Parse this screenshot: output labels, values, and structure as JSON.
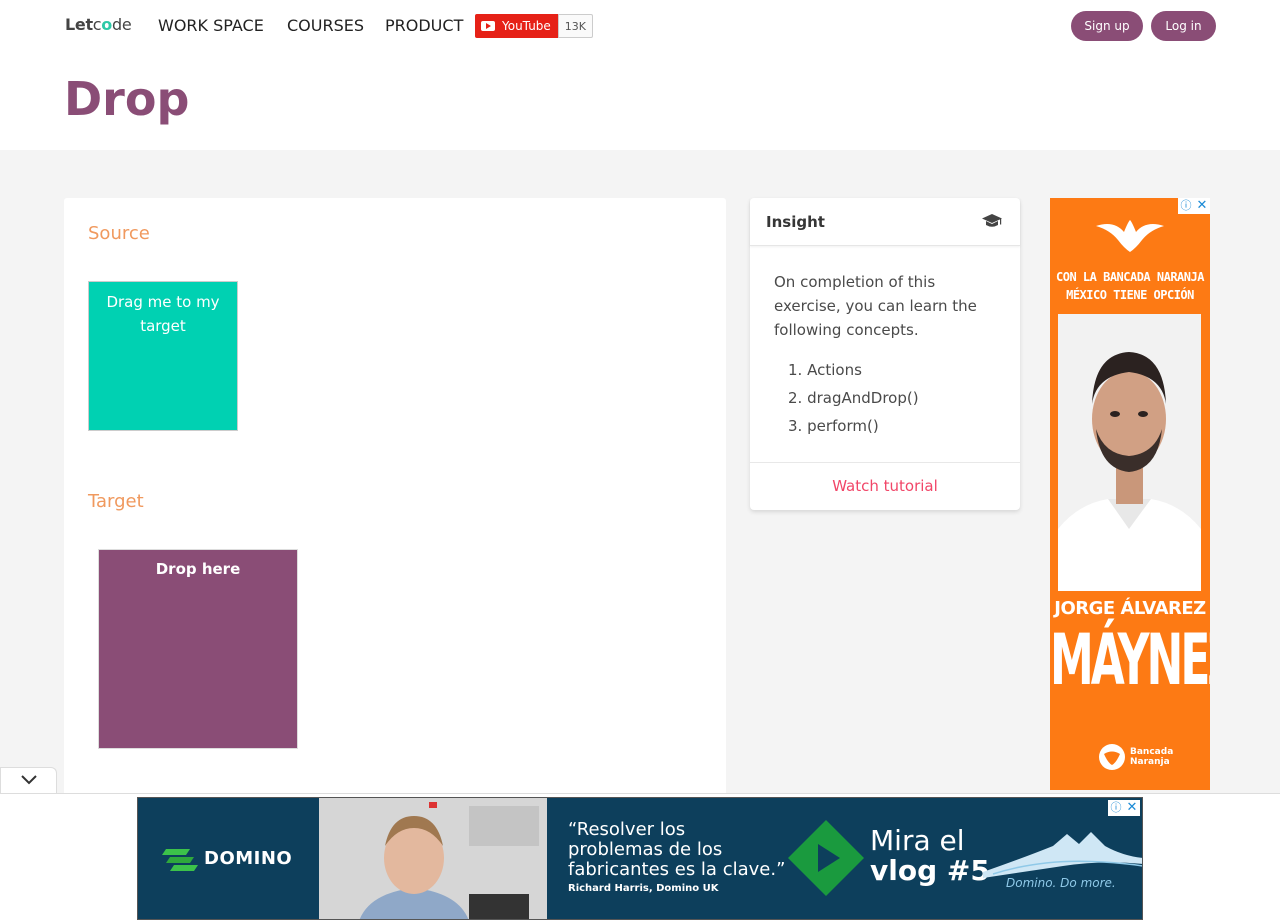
{
  "header": {
    "logo": {
      "let": "Let",
      "c": "c",
      "o": "o",
      "de": "de"
    },
    "nav": [
      "WORK SPACE",
      "COURSES",
      "PRODUCT"
    ],
    "youtube": {
      "label": "YouTube",
      "count": "13K"
    },
    "signup": "Sign up",
    "login": "Log in"
  },
  "page": {
    "title": "Drop"
  },
  "main": {
    "source_label": "Source",
    "source_box": "Drag me to my target",
    "target_label": "Target",
    "target_box": "Drop here"
  },
  "insight": {
    "title": "Insight",
    "icon": "graduation-cap-icon",
    "intro": "On completion of this exercise, you can learn the following concepts.",
    "items": [
      "Actions",
      "dragAndDrop()",
      "perform()"
    ],
    "link": "Watch tutorial"
  },
  "vertical_ad": {
    "line1": "CON LA BANCADA NARANJA",
    "line2": "MÉXICO TIENE OPCIÓN",
    "name": "JORGE ÁLVAREZ",
    "surname": "MÁYNEZ",
    "footer_l1": "Bancada",
    "footer_l2": "Naranja",
    "info": "ⓘ",
    "close": "✕",
    "color": "#fd7a14"
  },
  "bottom_ad": {
    "brand": "DOMINO",
    "quote_l1": "“Resolver los",
    "quote_l2": "problemas de los",
    "quote_l3": "fabricantes es la clave.”",
    "author": "Richard Harris, Domino UK",
    "vlog_l1": "Mira el",
    "vlog_l2": "vlog #5",
    "tagline": "Domino. Do more.",
    "info": "ⓘ",
    "close": "✕",
    "color": "#0d3f5c"
  },
  "colors": {
    "accent": "#8a4d76",
    "label": "#f0995e",
    "source": "#00d1b2",
    "link": "#f14668"
  }
}
